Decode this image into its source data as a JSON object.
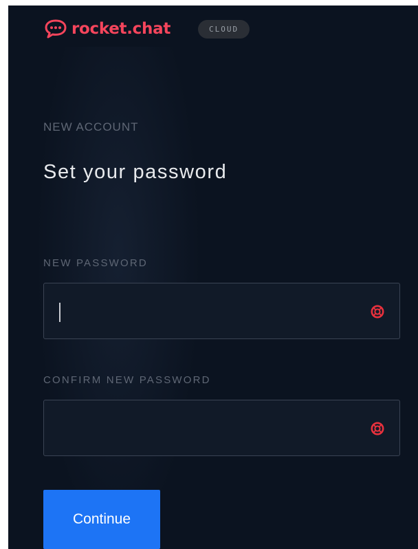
{
  "brand": {
    "name": "rocket.chat",
    "badge": "CLOUD",
    "logo_icon": "rocketchat-bubble-icon",
    "accent_color": "#f5455c"
  },
  "page": {
    "eyebrow": "NEW ACCOUNT",
    "title": "Set your password"
  },
  "form": {
    "new_password": {
      "label": "NEW PASSWORD",
      "value": "",
      "focused": true,
      "icon": "lifebuoy-icon"
    },
    "confirm_password": {
      "label": "CONFIRM NEW PASSWORD",
      "value": "",
      "icon": "lifebuoy-icon"
    },
    "submit_label": "Continue",
    "submit_color": "#1d74f5"
  }
}
